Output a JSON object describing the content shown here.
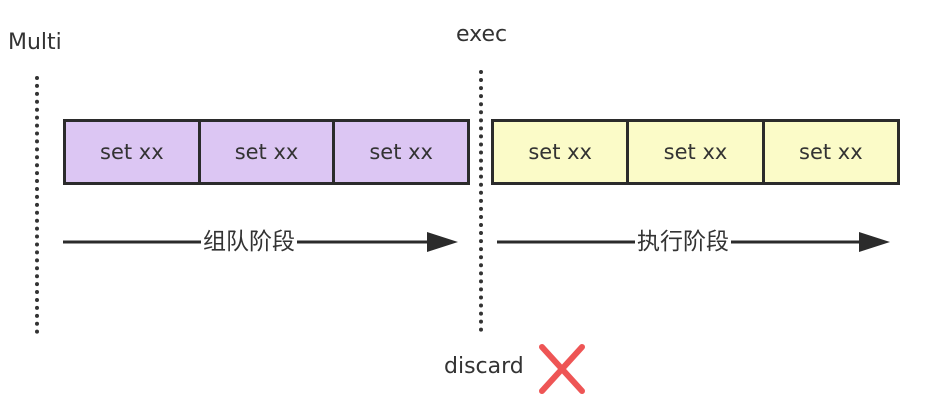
{
  "labels": {
    "multi": "Multi",
    "exec": "exec",
    "discard": "discard"
  },
  "queue_phase": {
    "label": "组队阶段",
    "commands": [
      "set xx",
      "set xx",
      "set xx"
    ]
  },
  "exec_phase": {
    "label": "执行阶段",
    "commands": [
      "set xx",
      "set xx",
      "set xx"
    ]
  },
  "colors": {
    "queue_fill": "#dcc6f3",
    "exec_fill": "#fbfbc8",
    "box_border": "#2b2b2b",
    "arrow": "#2b2b2b",
    "discard_cross": "#ee5555"
  },
  "icons": {
    "discard": "cross-icon"
  }
}
